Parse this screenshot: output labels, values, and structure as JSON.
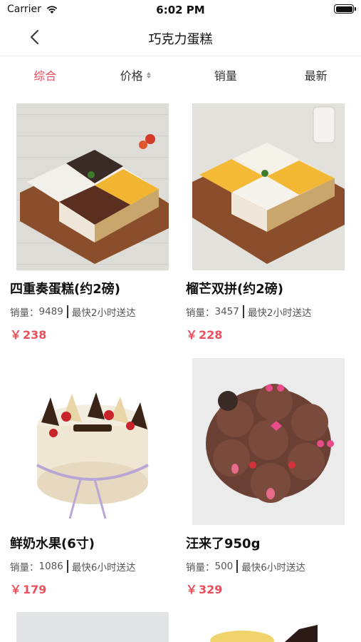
{
  "status_bar": {
    "carrier": "Carrier",
    "time": "6:02 PM"
  },
  "nav": {
    "title": "巧克力蛋糕"
  },
  "sort_tabs": [
    {
      "label": "综合",
      "active": true
    },
    {
      "label": "价格",
      "active": false
    },
    {
      "label": "销量",
      "active": false
    },
    {
      "label": "最新",
      "active": false
    }
  ],
  "products": [
    {
      "name": "四重奏蛋糕(约2磅)",
      "sales_label": "销量：",
      "sales": "9489",
      "delivery": "最快2小时送达",
      "currency": "￥",
      "price": "238"
    },
    {
      "name": "榴芒双拼(约2磅)",
      "sales_label": "销量：",
      "sales": "3457",
      "delivery": "最快2小时送达",
      "currency": "￥",
      "price": "228"
    },
    {
      "name": "鲜奶水果(6寸)",
      "sales_label": "销量：",
      "sales": "1086",
      "delivery": "最快6小时送达",
      "currency": "￥",
      "price": "179"
    },
    {
      "name": "汪来了950g",
      "sales_label": "销量：",
      "sales": "500",
      "delivery": "最快6小时送达",
      "currency": "￥",
      "price": "329"
    }
  ],
  "colors": {
    "accent": "#e8505b",
    "divider": "#e6e6e6"
  }
}
